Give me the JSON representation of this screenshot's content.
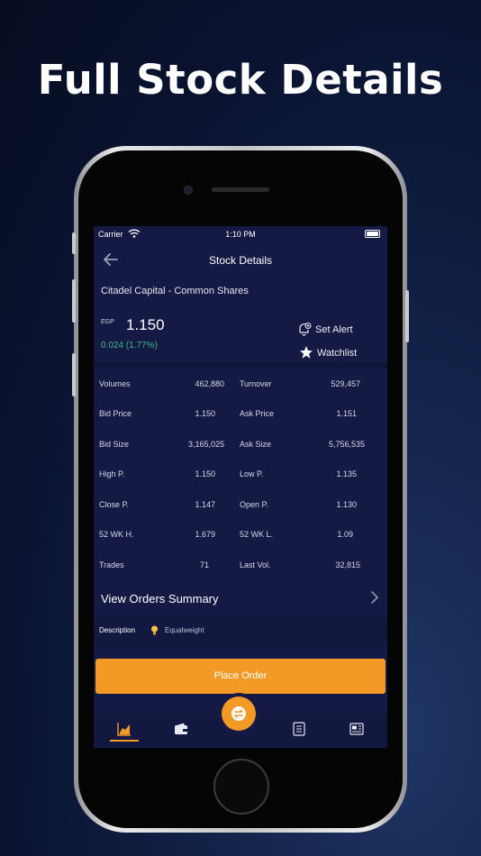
{
  "headline": "Full Stock Details",
  "status_bar": {
    "carrier": "Carrier",
    "time": "1:10 PM"
  },
  "nav": {
    "title": "Stock Details",
    "back_icon": "arrow-left-icon"
  },
  "stock": {
    "name": "Citadel Capital - Common Shares",
    "currency": "EGP",
    "price": "1.150",
    "change": "0.024 (1.77%)",
    "change_color": "#3fb88a"
  },
  "actions": {
    "set_alert": "Set Alert",
    "watchlist": "Watchlist"
  },
  "details": [
    {
      "label_left": "Volumes",
      "value_left": "462,880",
      "label_right": "Turnover",
      "value_right": "529,457"
    },
    {
      "label_left": "Bid Price",
      "value_left": "1.150",
      "label_right": "Ask Price",
      "value_right": "1.151"
    },
    {
      "label_left": "Bid Size",
      "value_left": "3,165,025",
      "label_right": "Ask Size",
      "value_right": "5,756,535"
    },
    {
      "label_left": "High P.",
      "value_left": "1.150",
      "label_right": "Low P.",
      "value_right": "1.135"
    },
    {
      "label_left": "Close P.",
      "value_left": "1.147",
      "label_right": "Open P.",
      "value_right": "1.130"
    },
    {
      "label_left": "52 WK H.",
      "value_left": "1.679",
      "label_right": "52 WK L.",
      "value_right": "1.09"
    },
    {
      "label_left": "Trades",
      "value_left": "71",
      "label_right": "Last Vol.",
      "value_right": "32,815"
    }
  ],
  "orders_summary": "View Orders Summary",
  "description": {
    "label": "Description",
    "value": "Equalweight"
  },
  "place_order": "Place Order",
  "tabs": [
    {
      "icon": "chart-icon",
      "active": true
    },
    {
      "icon": "wallet-icon",
      "active": false
    },
    {
      "icon": "trade-icon",
      "active": false
    },
    {
      "icon": "list-icon",
      "active": false
    },
    {
      "icon": "news-icon",
      "active": false
    }
  ],
  "colors": {
    "accent": "#f39a26",
    "screen_bg": "#141a44",
    "positive": "#3fb88a"
  }
}
